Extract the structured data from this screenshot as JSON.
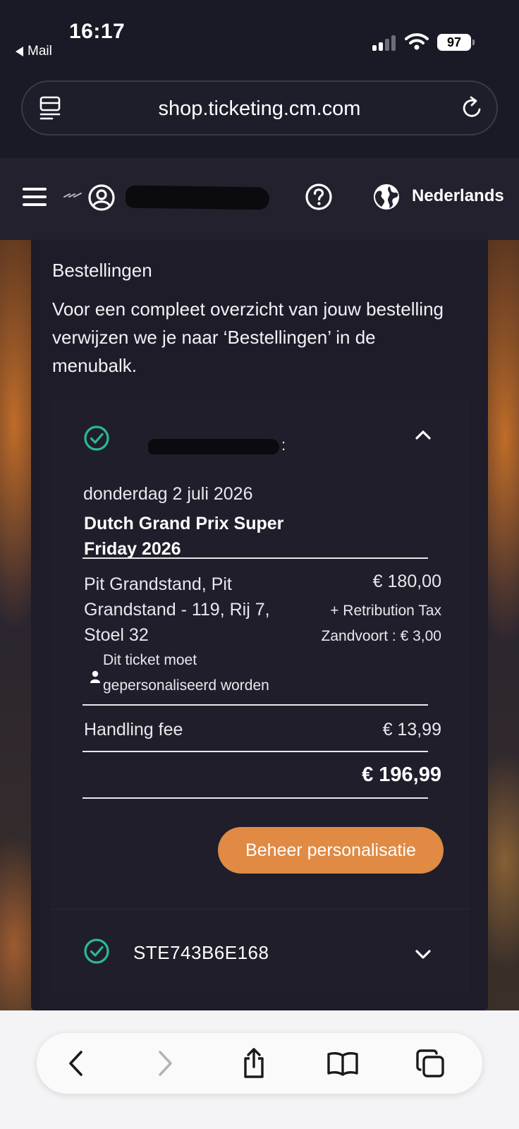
{
  "status_bar": {
    "time": "16:17",
    "back_app": "Mail",
    "battery": "97"
  },
  "browser": {
    "url": "shop.ticketing.cm.com"
  },
  "header": {
    "language": "Nederlands"
  },
  "orders_section": {
    "title": "Bestellingen",
    "intro": "Voor een compleet overzicht van jouw bestelling verwijzen we je naar ‘Bestellingen’ in de menubalk."
  },
  "order_expanded": {
    "date": "donderdag 2 juli 2026",
    "event_name": "Dutch Grand Prix Super Friday 2026",
    "seat": "Pit Grandstand, Pit Grandstand - 119, Rij 7, Stoel 32",
    "price": "€ 180,00",
    "tax": "+ Retribution Tax Zandvoort : € 3,00",
    "notice": "Dit ticket moet gepersonaliseerd worden",
    "handling_fee_label": "Handling fee",
    "handling_fee_value": "€ 13,99",
    "total": "€ 196,99",
    "manage_button": "Beheer personalisatie"
  },
  "order_collapsed": {
    "order_id": "STE743B6E168"
  },
  "colors": {
    "accent": "#e08a44",
    "success": "#2bb996",
    "card": "#1d1c28"
  },
  "icons": {
    "status": [
      "signal-icon",
      "wifi-icon",
      "battery-icon"
    ],
    "browser": [
      "reader-icon",
      "reload-icon"
    ],
    "header": [
      "menu-icon",
      "user-icon",
      "help-icon",
      "globe-icon"
    ],
    "order": [
      "check-circle-icon",
      "chevron-up-icon",
      "person-icon",
      "chevron-down-icon"
    ],
    "toolbar": [
      "back-icon",
      "forward-icon",
      "share-icon",
      "bookmarks-icon",
      "tabs-icon"
    ]
  }
}
